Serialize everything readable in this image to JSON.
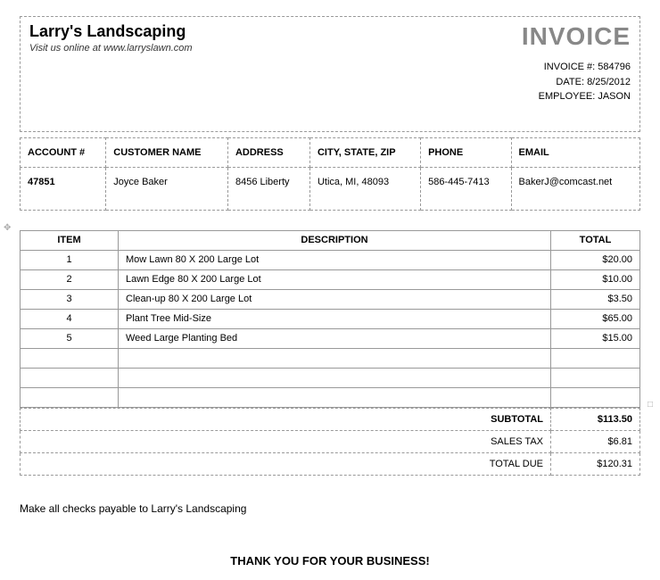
{
  "company": {
    "name": "Larry's Landscaping",
    "tagline": "Visit us online at www.larryslawn.com"
  },
  "invoice": {
    "title": "INVOICE",
    "number_label": "INVOICE #: ",
    "number": "584796",
    "date_label": "DATE: ",
    "date": "8/25/2012",
    "employee_label": "EMPLOYEE: ",
    "employee": "JASON"
  },
  "customer_headers": {
    "account": "ACCOUNT #",
    "name": "CUSTOMER NAME",
    "address": "ADDRESS",
    "csz": "CITY, STATE, ZIP",
    "phone": "PHONE",
    "email": "EMAIL"
  },
  "customer": {
    "account": "47851",
    "name": "Joyce Baker",
    "address": "8456 Liberty",
    "csz": "Utica, MI, 48093",
    "phone": "586-445-7413",
    "email": "BakerJ@comcast.net"
  },
  "item_headers": {
    "item": "ITEM",
    "description": "DESCRIPTION",
    "total": "TOTAL"
  },
  "line_items": [
    {
      "num": "1",
      "desc": "Mow Lawn 80 X 200 Large Lot",
      "total": "$20.00"
    },
    {
      "num": "2",
      "desc": "Lawn Edge 80 X 200 Large Lot",
      "total": "$10.00"
    },
    {
      "num": "3",
      "desc": "Clean-up 80 X 200 Large Lot",
      "total": "$3.50"
    },
    {
      "num": "4",
      "desc": "Plant Tree Mid-Size",
      "total": "$65.00"
    },
    {
      "num": "5",
      "desc": "Weed Large Planting Bed",
      "total": "$15.00"
    }
  ],
  "totals": {
    "subtotal_label": "SUBTOTAL",
    "subtotal": "$113.50",
    "tax_label": "SALES TAX",
    "tax": "$6.81",
    "due_label": "TOTAL DUE",
    "due": "$120.31"
  },
  "payable": "Make all checks payable to Larry's Landscaping",
  "thanks": "THANK YOU FOR YOUR BUSINESS!"
}
